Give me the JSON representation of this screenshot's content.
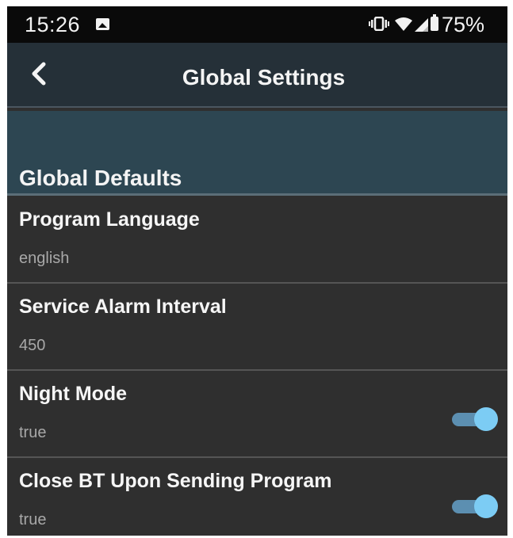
{
  "status_bar": {
    "time": "15:26",
    "battery": "75%",
    "icons": [
      "gallery-icon",
      "vibrate-icon",
      "wifi-icon",
      "signal-icon",
      "battery-icon"
    ]
  },
  "header": {
    "title": "Global Settings",
    "back_icon": "chevron-left-icon"
  },
  "section": {
    "title": "Global Defaults"
  },
  "preferences": [
    {
      "title": "Program Language",
      "value": "english"
    },
    {
      "title": "Service Alarm Interval",
      "value": "450"
    },
    {
      "title": "Night Mode",
      "value": "true",
      "toggle": true
    },
    {
      "title": "Close BT Upon Sending Program",
      "value": "true",
      "toggle": true
    }
  ],
  "colors": {
    "status_bar_bg": "#0a0a0a",
    "app_bar_bg": "#253038",
    "section_bg": "#2d4652",
    "list_bg": "#2f2f2f",
    "toggle_track": "#5c8fb1",
    "toggle_thumb": "#7cccf4"
  }
}
